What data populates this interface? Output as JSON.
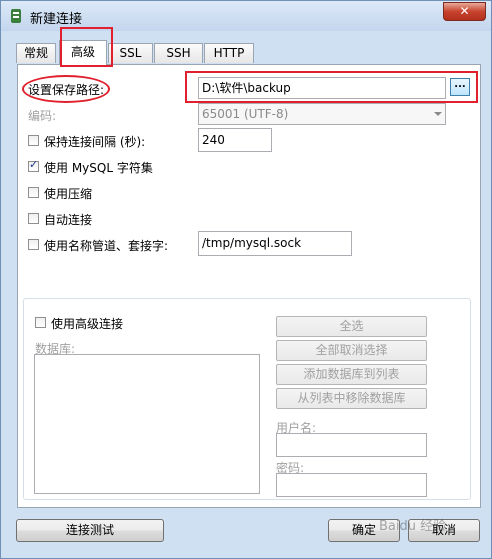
{
  "window": {
    "title": "新建连接",
    "close_label": "✕"
  },
  "tabs": [
    "常规",
    "高级",
    "SSL",
    "SSH",
    "HTTP"
  ],
  "active_tab": "高级",
  "fields": {
    "save_path_label": "设置保存路径:",
    "save_path_value": "D:\\软件\\backup",
    "browse_label": "...",
    "encoding_label": "编码:",
    "encoding_value": "65001 (UTF-8)",
    "keepalive_label": "保持连接间隔 (秒):",
    "keepalive_value": "240",
    "use_mysql_charset_label": "使用 MySQL 字符集",
    "use_compression_label": "使用压缩",
    "auto_connect_label": "自动连接",
    "use_named_pipe_label": "使用名称管道、套接字:",
    "named_pipe_value": "/tmp/mysql.sock"
  },
  "checkbox_states": {
    "keepalive": false,
    "use_mysql_charset": true,
    "use_compression": false,
    "auto_connect": false,
    "use_named_pipe": false,
    "use_advanced": false
  },
  "advanced": {
    "use_advanced_label": "使用高级连接",
    "databases_label": "数据库:",
    "select_all": "全选",
    "deselect_all": "全部取消选择",
    "add_db": "添加数据库到列表",
    "remove_db": "从列表中移除数据库",
    "username_label": "用户名:",
    "password_label": "密码:"
  },
  "footer": {
    "test_button": "连接测试",
    "ok_button": "确定",
    "cancel_button": "取消"
  },
  "watermark": "Baidu 经验"
}
